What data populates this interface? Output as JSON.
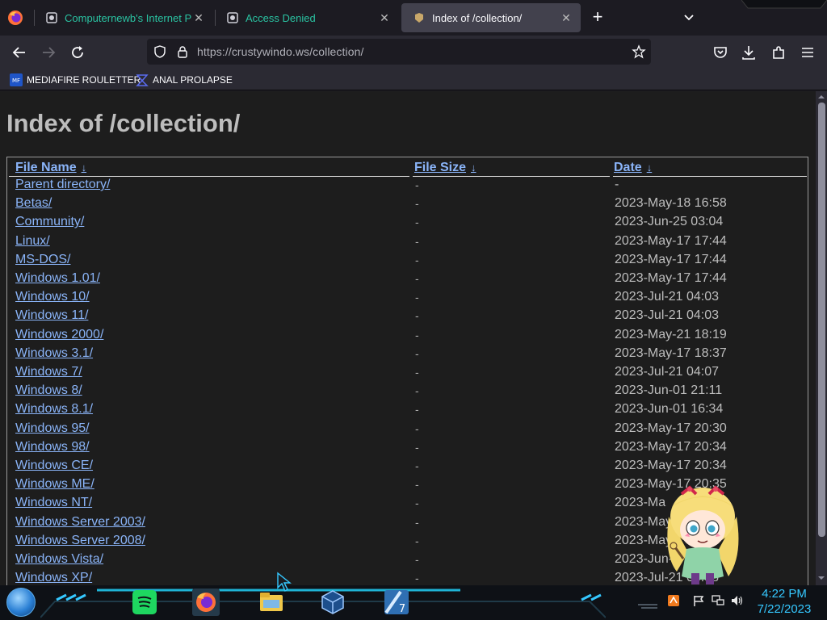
{
  "browser": {
    "tabs": [
      {
        "title": "Computernewb's Internet Pub",
        "active": false
      },
      {
        "title": "Access Denied",
        "active": false
      },
      {
        "title": "Index of /collection/",
        "active": true
      }
    ],
    "new_tab_label": "+",
    "close_glyph": "✕",
    "url": "https://crustywindo.ws/collection/",
    "bookmarks": [
      {
        "label": "MEDIAFIRE ROULETTER",
        "icon": "mediafire-icon"
      },
      {
        "label": "ANAL PROLAPSE",
        "icon": "bookmark-icon"
      }
    ]
  },
  "page": {
    "title": "Index of /collection/",
    "columns": {
      "name": "File Name",
      "size": "File Size",
      "date": "Date",
      "sort_arrow": "↓"
    },
    "rows": [
      {
        "name": "Parent directory/",
        "size": "-",
        "date": "-"
      },
      {
        "name": "Betas/",
        "size": "-",
        "date": "2023-May-18 16:58"
      },
      {
        "name": "Community/",
        "size": "-",
        "date": "2023-Jun-25 03:04"
      },
      {
        "name": "Linux/",
        "size": "-",
        "date": "2023-May-17 17:44"
      },
      {
        "name": "MS-DOS/",
        "size": "-",
        "date": "2023-May-17 17:44"
      },
      {
        "name": "Windows 1.01/",
        "size": "-",
        "date": "2023-May-17 17:44"
      },
      {
        "name": "Windows 10/",
        "size": "-",
        "date": "2023-Jul-21 04:03"
      },
      {
        "name": "Windows 11/",
        "size": "-",
        "date": "2023-Jul-21 04:03"
      },
      {
        "name": "Windows 2000/",
        "size": "-",
        "date": "2023-May-21 18:19"
      },
      {
        "name": "Windows 3.1/",
        "size": "-",
        "date": "2023-May-17 18:37"
      },
      {
        "name": "Windows 7/",
        "size": "-",
        "date": "2023-Jul-21 04:07"
      },
      {
        "name": "Windows 8/",
        "size": "-",
        "date": "2023-Jun-01 21:11"
      },
      {
        "name": "Windows 8.1/",
        "size": "-",
        "date": "2023-Jun-01 16:34"
      },
      {
        "name": "Windows 95/",
        "size": "-",
        "date": "2023-May-17 20:30"
      },
      {
        "name": "Windows 98/",
        "size": "-",
        "date": "2023-May-17 20:34"
      },
      {
        "name": "Windows CE/",
        "size": "-",
        "date": "2023-May-17 20:34"
      },
      {
        "name": "Windows ME/",
        "size": "-",
        "date": "2023-May-17 20:35"
      },
      {
        "name": "Windows NT/",
        "size": "-",
        "date": "2023-Ma"
      },
      {
        "name": "Windows Server 2003/",
        "size": "-",
        "date": "2023-May-"
      },
      {
        "name": "Windows Server 2008/",
        "size": "-",
        "date": "2023-May"
      },
      {
        "name": "Windows Vista/",
        "size": "-",
        "date": "2023-Jun-"
      },
      {
        "name": "Windows XP/",
        "size": "-",
        "date": "2023-Jul-21 03:58"
      }
    ]
  },
  "taskbar": {
    "pinned_apps": [
      "spotify-icon",
      "firefox-icon",
      "file-explorer-icon",
      "virtualbox-icon",
      "app-64-icon"
    ],
    "app_badge": "7",
    "tray_icons": [
      "app-tray-icon",
      "flag-icon",
      "network-icon",
      "volume-icon"
    ],
    "clock": {
      "time": "4:22 PM",
      "date": "7/22/2023"
    }
  },
  "colors": {
    "link": "#8ab4f8",
    "tab_accent": "#2ac3a2",
    "clock": "#35c8ff",
    "page_bg": "#1d1d1d",
    "chrome_bg": "#2b2a33"
  }
}
